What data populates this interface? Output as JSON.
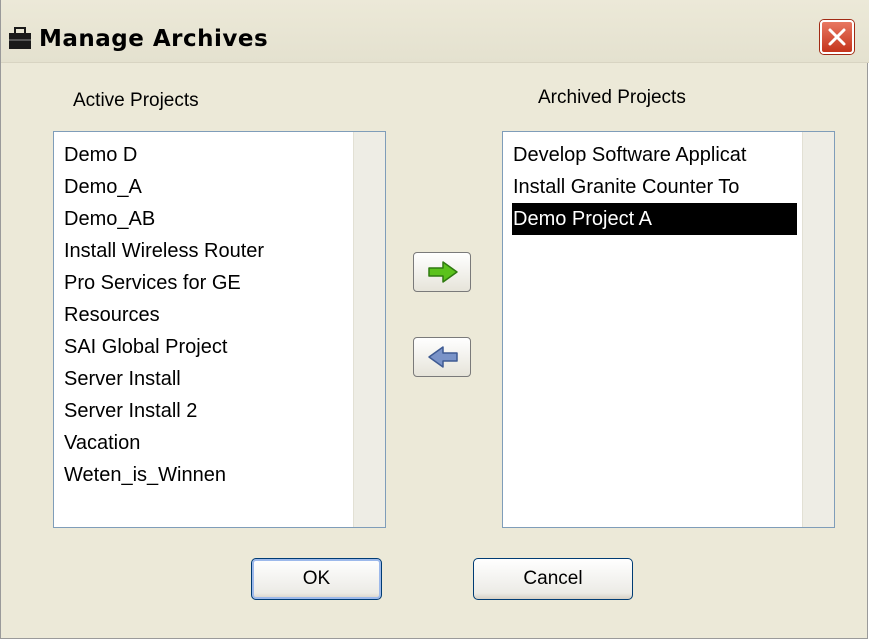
{
  "window": {
    "title": "Manage Archives"
  },
  "icons": {
    "title": "briefcase-icon",
    "close": "close-icon",
    "move_right": "arrow-right-icon",
    "move_left": "arrow-left-icon"
  },
  "colors": {
    "close_button": "#d5462c",
    "arrow_right": "#5bc21c",
    "arrow_left": "#7a93c8",
    "selection": "#000000"
  },
  "active": {
    "heading": "Active Projects",
    "items": [
      "Demo D",
      "Demo_A",
      "Demo_AB",
      "Install Wireless Router",
      "Pro Services for GE",
      "Resources",
      "SAI Global Project",
      "Server Install",
      "Server Install 2",
      "Vacation",
      "Weten_is_Winnen"
    ]
  },
  "archived": {
    "heading": "Archived Projects",
    "items": [
      "Develop Software Applicat",
      "Install Granite Counter To",
      "Demo Project A"
    ],
    "selected_item": "Demo Project A"
  },
  "buttons": {
    "ok": "OK",
    "cancel": "Cancel"
  }
}
